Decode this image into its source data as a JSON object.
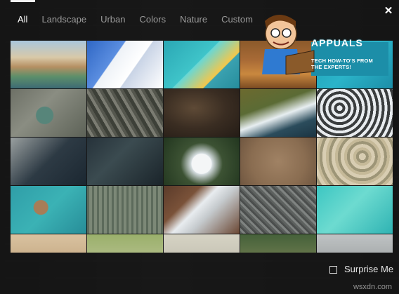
{
  "tabs": [
    {
      "label": "All",
      "active": true
    },
    {
      "label": "Landscape",
      "active": false
    },
    {
      "label": "Urban",
      "active": false
    },
    {
      "label": "Colors",
      "active": false
    },
    {
      "label": "Nature",
      "active": false
    },
    {
      "label": "Custom",
      "active": false
    }
  ],
  "close_icon": "close-icon",
  "wallpapers": [
    "beach-rock-wallpaper",
    "white-building-wallpaper",
    "material-geometric-wallpaper",
    "logo-overlay-wallpaper",
    "logo-overlay-wallpaper-2",
    "aerial-city-wallpaper",
    "mountain-range-wallpaper",
    "canyon-aerial-wallpaper",
    "coastal-cliffs-wallpaper",
    "snowy-peaks-wallpaper",
    "coastline-aerial-wallpaper",
    "dark-terrain-wallpaper",
    "volcano-snow-wallpaper",
    "desert-aerial-wallpaper",
    "quarry-rings-wallpaper",
    "venice-aerial-wallpaper",
    "forbidden-city-wallpaper",
    "river-snow-wallpaper",
    "city-grid-wallpaper",
    "turquoise-reef-wallpaper",
    "desert-partial-wallpaper",
    "field-partial-wallpaper",
    "plain-partial-wallpaper",
    "farmland-partial-wallpaper",
    "highway-partial-wallpaper"
  ],
  "logo": {
    "wordmark": "APPUALS",
    "tagline_1": "TECH HOW-TO'S FROM",
    "tagline_2": "THE EXPERTS!"
  },
  "surprise_me": {
    "label": "Surprise Me",
    "checked": false
  },
  "watermark": "wsxdn.com"
}
